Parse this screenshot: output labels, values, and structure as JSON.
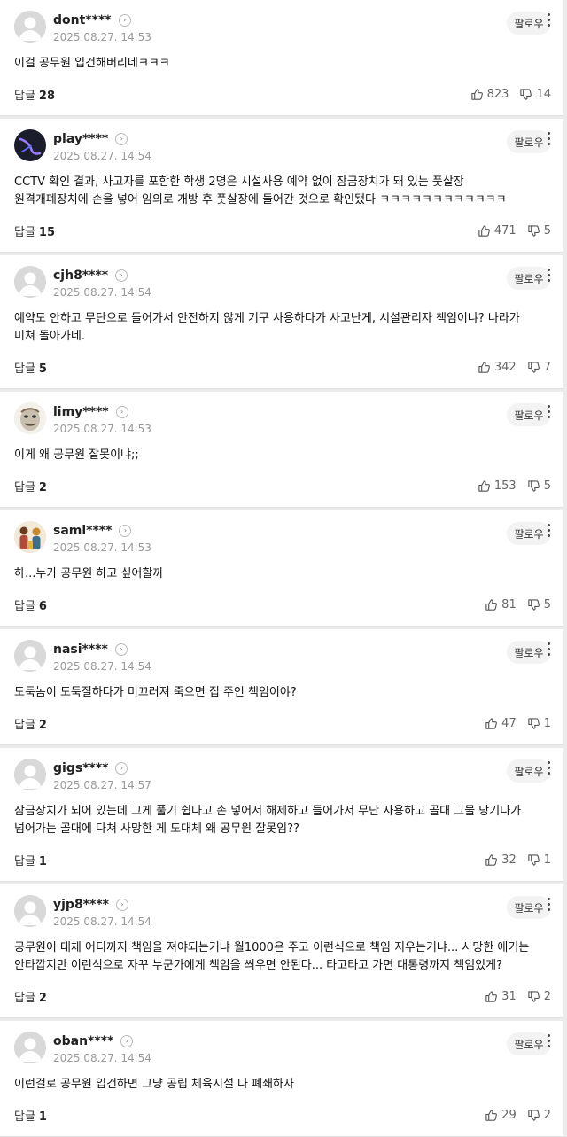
{
  "labels": {
    "follow": "팔로우",
    "reply": "답글"
  },
  "comments": [
    {
      "nick": "dont****",
      "date": "2025.08.27. 14:53",
      "avatar": "default",
      "text": "이걸 공무원 입건해버리네ㅋㅋㅋ",
      "replies": "28",
      "likes": "823",
      "dislikes": "14"
    },
    {
      "nick": "play****",
      "date": "2025.08.27. 14:54",
      "avatar": "dark-swirl",
      "text": "CCTV 확인 결과, 사고자를 포함한 학생 2명은 시설사용 예약 없이 잠금장치가 돼 있는 풋살장 원격개폐장치에 손을 넣어 임의로 개방 후 풋살장에 들어간 것으로 확인됐다 ㅋㅋㅋㅋㅋㅋㅋㅋㅋㅋㅋㅋ",
      "replies": "15",
      "likes": "471",
      "dislikes": "5"
    },
    {
      "nick": "cjh8****",
      "date": "2025.08.27. 14:54",
      "avatar": "default",
      "text": "예약도 안하고 무단으로 들어가서 안전하지 않게 기구 사용하다가 사고난게, 시설관리자 책임이냐? 나라가 미쳐 돌아가네.",
      "replies": "5",
      "likes": "342",
      "dislikes": "7"
    },
    {
      "nick": "limy****",
      "date": "2025.08.27. 14:53",
      "avatar": "mask",
      "text": "이게 왜 공무원 잘못이냐;;",
      "replies": "2",
      "likes": "153",
      "dislikes": "5"
    },
    {
      "nick": "saml****",
      "date": "2025.08.27. 14:53",
      "avatar": "illustration",
      "text": "하...누가 공무원 하고 싶어할까",
      "replies": "6",
      "likes": "81",
      "dislikes": "5"
    },
    {
      "nick": "nasi****",
      "date": "2025.08.27. 14:54",
      "avatar": "default",
      "text": "도둑놈이 도둑질하다가 미끄러져 죽으면 집 주인 책임이야?",
      "replies": "2",
      "likes": "47",
      "dislikes": "1"
    },
    {
      "nick": "gigs****",
      "date": "2025.08.27. 14:57",
      "avatar": "default",
      "text": "잠금장치가 되어 있는데 그게 풀기 쉽다고 손 넣어서 해제하고 들어가서 무단 사용하고 골대 그물 당기다가 넘어가는 골대에 다쳐 사망한 게 도대체 왜 공무원 잘못임??",
      "replies": "1",
      "likes": "32",
      "dislikes": "1"
    },
    {
      "nick": "yjp8****",
      "date": "2025.08.27. 14:54",
      "avatar": "default",
      "text": "공무원이 대체 어디까지 책임을 져야되는거냐 월1000은 주고 이런식으로 책임 지우는거냐... 사망한 애기는 안타깝지만 이런식으로 자꾸 누군가에게 책임을 씌우면 안된다... 타고타고 가면 대통령까지 책임있게?",
      "replies": "2",
      "likes": "31",
      "dislikes": "2"
    },
    {
      "nick": "oban****",
      "date": "2025.08.27. 14:54",
      "avatar": "default",
      "text": "이런걸로 공무원 입건하면 그냥 공립 체육시설 다 폐쇄하자",
      "replies": "1",
      "likes": "29",
      "dislikes": "2"
    }
  ]
}
